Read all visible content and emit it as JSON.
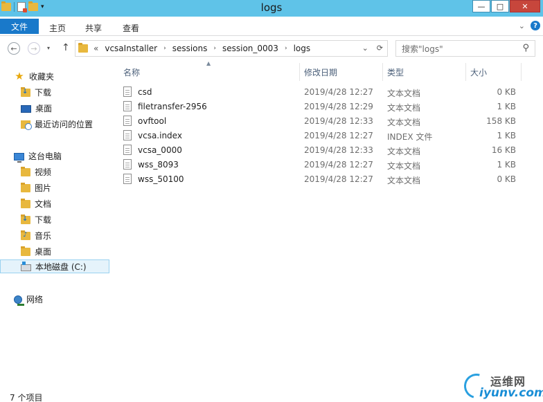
{
  "window": {
    "title": "logs",
    "buttons": {
      "minimize": "—",
      "maximize": "□",
      "close": "✕"
    }
  },
  "quick_access": {
    "dropdown": "▾"
  },
  "ribbon": {
    "file_tab": "文件",
    "tabs": [
      "主页",
      "共享",
      "查看"
    ],
    "expand": "⌄",
    "help": "?"
  },
  "nav": {
    "back": "←",
    "forward": "→",
    "history": "▾",
    "up": "↑",
    "breadcrumb_lead": "«",
    "breadcrumb": [
      "vcsaInstaller",
      "sessions",
      "session_0003",
      "logs"
    ],
    "crumb_sep": "›",
    "addr_dropdown": "⌄",
    "refresh": "⟳",
    "search_placeholder": "搜索\"logs\"",
    "search_icon": "⚲"
  },
  "sidebar": {
    "favorites": {
      "label": "收藏夹",
      "items": [
        "下载",
        "桌面",
        "最近访问的位置"
      ]
    },
    "this_pc": {
      "label": "这台电脑",
      "items": [
        "视频",
        "图片",
        "文档",
        "下载",
        "音乐",
        "桌面",
        "本地磁盘 (C:)"
      ]
    },
    "network": {
      "label": "网络"
    }
  },
  "columns": {
    "name": "名称",
    "date": "修改日期",
    "type": "类型",
    "size": "大小",
    "sort_indicator": "▲"
  },
  "files": [
    {
      "name": "csd",
      "date": "2019/4/28 12:27",
      "type": "文本文档",
      "size": "0 KB"
    },
    {
      "name": "filetransfer-2956",
      "date": "2019/4/28 12:29",
      "type": "文本文档",
      "size": "1 KB"
    },
    {
      "name": "ovftool",
      "date": "2019/4/28 12:33",
      "type": "文本文档",
      "size": "158 KB"
    },
    {
      "name": "vcsa.index",
      "date": "2019/4/28 12:27",
      "type": "INDEX 文件",
      "size": "1 KB"
    },
    {
      "name": "vcsa_0000",
      "date": "2019/4/28 12:33",
      "type": "文本文档",
      "size": "16 KB"
    },
    {
      "name": "wss_8093",
      "date": "2019/4/28 12:27",
      "type": "文本文档",
      "size": "1 KB"
    },
    {
      "name": "wss_50100",
      "date": "2019/4/28 12:27",
      "type": "文本文档",
      "size": "0 KB"
    }
  ],
  "status": {
    "count": "7 个项目"
  },
  "watermark": {
    "cn": "运维网",
    "en": "iyunv.com"
  },
  "colors": {
    "titlebar": "#5fc3e8",
    "file_tab": "#1979ca",
    "selected": "#e5f3fb"
  }
}
